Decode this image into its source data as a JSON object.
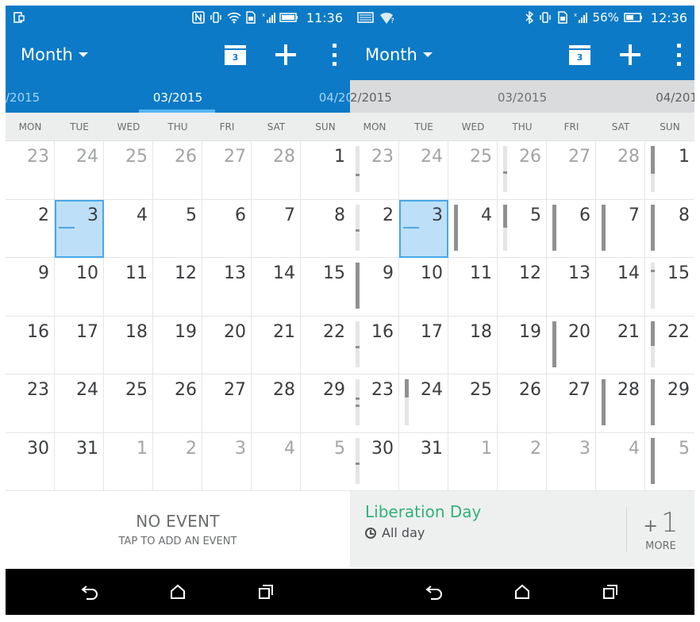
{
  "colors": {
    "accent": "#0c7ac6",
    "today_fill": "#bde0f8",
    "event_green": "#33b07a"
  },
  "left": {
    "status": {
      "time": "11:36",
      "icons": [
        "portrait-lock-icon",
        "nfc-icon",
        "vibrate-icon",
        "wifi-icon",
        "sim-icon",
        "signal-icon",
        "battery-icon"
      ]
    },
    "view_label": "Month",
    "today_badge": "3",
    "months": {
      "prev": "/2015",
      "current": "03/2015",
      "next": "04/20"
    },
    "weekdays": [
      "MON",
      "TUE",
      "WED",
      "THU",
      "FRI",
      "SAT",
      "SUN"
    ],
    "days": [
      "23",
      "24",
      "25",
      "26",
      "27",
      "28",
      "1",
      "2",
      "3",
      "4",
      "5",
      "6",
      "7",
      "8",
      "9",
      "10",
      "11",
      "12",
      "13",
      "14",
      "15",
      "16",
      "17",
      "18",
      "19",
      "20",
      "21",
      "22",
      "23",
      "24",
      "25",
      "26",
      "27",
      "28",
      "29",
      "30",
      "31",
      "1",
      "2",
      "3",
      "4",
      "5"
    ],
    "no_event": "NO EVENT",
    "tap_add": "TAP TO ADD AN EVENT"
  },
  "right": {
    "status": {
      "time": "12:36",
      "battery": "56%",
      "icons": [
        "image-icon",
        "wifi-question-icon",
        "bluetooth-icon",
        "vibrate-icon",
        "sim-icon",
        "signal-icon",
        "battery-icon"
      ]
    },
    "view_label": "Month",
    "today_badge": "3",
    "months": {
      "prev": "2/2015",
      "current": "03/2015",
      "next": "04/201"
    },
    "weekdays": [
      "MON",
      "TUE",
      "WED",
      "THU",
      "FRI",
      "SAT",
      "SUN"
    ],
    "days": [
      "23",
      "24",
      "25",
      "26",
      "27",
      "28",
      "1",
      "2",
      "3",
      "4",
      "5",
      "6",
      "7",
      "8",
      "9",
      "10",
      "11",
      "12",
      "13",
      "14",
      "15",
      "16",
      "17",
      "18",
      "19",
      "20",
      "21",
      "22",
      "23",
      "24",
      "25",
      "26",
      "27",
      "28",
      "29",
      "30",
      "31",
      "1",
      "2",
      "3",
      "4",
      "5"
    ],
    "event": {
      "title": "Liberation Day",
      "time": "All day"
    },
    "more": {
      "plus": "+",
      "count": "1",
      "label": "MORE"
    }
  }
}
